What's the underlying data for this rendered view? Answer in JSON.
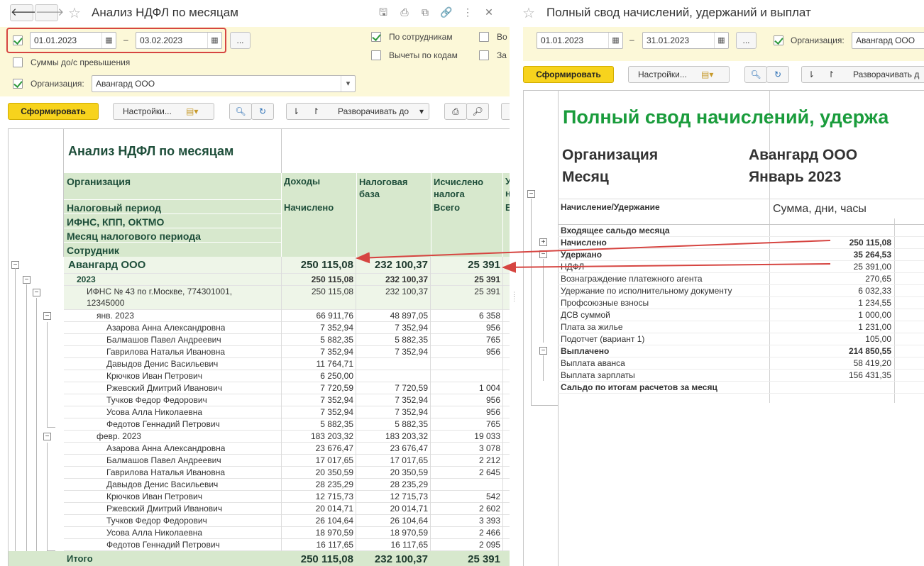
{
  "left": {
    "title": "Анализ НДФЛ по месяцам",
    "date_from": "01.01.2023",
    "date_sep": "–",
    "date_to": "03.02.2023",
    "more_btn": "...",
    "opt_by_employee": "По сотрудникам",
    "opt_deductions": "Вычеты по кодам",
    "opt_cut1": "Во",
    "opt_cut2": "За",
    "opt_excess": "Суммы до/с превышения",
    "org_label": "Организация:",
    "org_value": "Авангард ООО",
    "btn_generate": "Сформировать",
    "btn_settings": "Настройки...",
    "btn_expand": "Разворачивать до",
    "report_title": "Анализ НДФЛ по месяцам",
    "headers": {
      "org": "Организация",
      "period": "Налоговый период",
      "ifns": "ИФНС, КПП, ОКТМО",
      "month": "Месяц налогового периода",
      "employee": "Сотрудник",
      "income": "Доходы",
      "accrued": "Начислено",
      "base": "Налоговая база",
      "calc": "Исчислено налога",
      "total": "Всего",
      "cut": "У",
      "cut2": "н",
      "cut3": "В"
    },
    "rows": [
      {
        "name": "Авангард ООО",
        "income": "250 115,08",
        "base": "232 100,37",
        "calc": "25 391",
        "level": "org"
      },
      {
        "name": "2023",
        "income": "250 115,08",
        "base": "232 100,37",
        "calc": "25 391",
        "level": "year"
      },
      {
        "name": "ИФНС № 43 по г.Москве, 774301001,",
        "name2": "12345000",
        "income": "250 115,08",
        "base": "232 100,37",
        "calc": "25 391",
        "level": "ifns"
      },
      {
        "name": "янв. 2023",
        "income": "66 911,76",
        "base": "48 897,05",
        "calc": "6 358",
        "level": "month"
      },
      {
        "name": "Азарова Анна Александровна",
        "income": "7 352,94",
        "base": "7 352,94",
        "calc": "956",
        "level": "emp"
      },
      {
        "name": "Балмашов Павел Андреевич",
        "income": "5 882,35",
        "base": "5 882,35",
        "calc": "765",
        "level": "emp"
      },
      {
        "name": "Гаврилова Наталья Ивановна",
        "income": "7 352,94",
        "base": "7 352,94",
        "calc": "956",
        "level": "emp"
      },
      {
        "name": "Давыдов Денис Васильевич",
        "income": "11 764,71",
        "base": "",
        "calc": "",
        "level": "emp"
      },
      {
        "name": "Крючков Иван Петрович",
        "income": "6 250,00",
        "base": "",
        "calc": "",
        "level": "emp"
      },
      {
        "name": "Ржевский Дмитрий Иванович",
        "income": "7 720,59",
        "base": "7 720,59",
        "calc": "1 004",
        "level": "emp"
      },
      {
        "name": "Тучков Федор Федорович",
        "income": "7 352,94",
        "base": "7 352,94",
        "calc": "956",
        "level": "emp"
      },
      {
        "name": "Усова Алла Николаевна",
        "income": "7 352,94",
        "base": "7 352,94",
        "calc": "956",
        "level": "emp"
      },
      {
        "name": "Федотов Геннадий Петрович",
        "income": "5 882,35",
        "base": "5 882,35",
        "calc": "765",
        "level": "emp"
      },
      {
        "name": "февр. 2023",
        "income": "183 203,32",
        "base": "183 203,32",
        "calc": "19 033",
        "level": "month"
      },
      {
        "name": "Азарова Анна Александровна",
        "income": "23 676,47",
        "base": "23 676,47",
        "calc": "3 078",
        "level": "emp"
      },
      {
        "name": "Балмашов Павел Андреевич",
        "income": "17 017,65",
        "base": "17 017,65",
        "calc": "2 212",
        "level": "emp"
      },
      {
        "name": "Гаврилова Наталья Ивановна",
        "income": "20 350,59",
        "base": "20 350,59",
        "calc": "2 645",
        "level": "emp"
      },
      {
        "name": "Давыдов Денис Васильевич",
        "income": "28 235,29",
        "base": "28 235,29",
        "calc": "",
        "level": "emp"
      },
      {
        "name": "Крючков Иван Петрович",
        "income": "12 715,73",
        "base": "12 715,73",
        "calc": "542",
        "level": "emp"
      },
      {
        "name": "Ржевский Дмитрий Иванович",
        "income": "20 014,71",
        "base": "20 014,71",
        "calc": "2 602",
        "level": "emp"
      },
      {
        "name": "Тучков Федор Федорович",
        "income": "26 104,64",
        "base": "26 104,64",
        "calc": "3 393",
        "level": "emp"
      },
      {
        "name": "Усова Алла Николаевна",
        "income": "18 970,59",
        "base": "18 970,59",
        "calc": "2 466",
        "level": "emp"
      },
      {
        "name": "Федотов Геннадий Петрович",
        "income": "16 117,65",
        "base": "16 117,65",
        "calc": "2 095",
        "level": "emp"
      }
    ],
    "total": {
      "name": "Итого",
      "income": "250 115,08",
      "base": "232 100,37",
      "calc": "25 391"
    }
  },
  "right": {
    "title": "Полный свод начислений, удержаний и выплат",
    "date_from": "01.01.2023",
    "date_sep": "–",
    "date_to": "31.01.2023",
    "more_btn": "...",
    "org_label": "Организация:",
    "org_value": "Авангард ООО",
    "btn_generate": "Сформировать",
    "btn_settings": "Настройки...",
    "btn_expand": "Разворачивать д",
    "report_title": "Полный свод начислений, удержа",
    "org_caption": "Организация",
    "org_name": "Авангард ООО",
    "month_caption": "Месяц",
    "month_value": "Январь 2023",
    "col_item": "Начисление/Удержание",
    "col_sum": "Сумма, дни, часы",
    "rows": [
      {
        "name": "Входящее сальдо месяца",
        "value": "",
        "bold": true,
        "ind": 0
      },
      {
        "name": "Начислено",
        "value": "250 115,08",
        "bold": true,
        "ind": 0
      },
      {
        "name": "Удержано",
        "value": "35 264,53",
        "bold": true,
        "ind": 0
      },
      {
        "name": "НДФЛ",
        "value": "25 391,00",
        "bold": false,
        "ind": 0
      },
      {
        "name": "Вознаграждение платежного агента",
        "value": "270,65",
        "bold": false,
        "ind": 0
      },
      {
        "name": "Удержание по исполнительному документу",
        "value": "6 032,33",
        "bold": false,
        "ind": 0
      },
      {
        "name": "Профсоюзные взносы",
        "value": "1 234,55",
        "bold": false,
        "ind": 0
      },
      {
        "name": "ДСВ суммой",
        "value": "1 000,00",
        "bold": false,
        "ind": 0
      },
      {
        "name": "Плата за жилье",
        "value": "1 231,00",
        "bold": false,
        "ind": 0
      },
      {
        "name": "Подотчет (вариант 1)",
        "value": "105,00",
        "bold": false,
        "ind": 0
      },
      {
        "name": "Выплачено",
        "value": "214 850,55",
        "bold": true,
        "ind": 0
      },
      {
        "name": "Выплата аванса",
        "value": "58 419,20",
        "bold": false,
        "ind": 0
      },
      {
        "name": "Выплата зарплаты",
        "value": "156 431,35",
        "bold": false,
        "ind": 0
      },
      {
        "name": "Сальдо по итогам расчетов за месяц",
        "value": "",
        "bold": true,
        "ind": 0
      }
    ]
  },
  "colors": {
    "accent_green": "#1a9c3c",
    "header_green": "#d7e8cd",
    "row_green": "#eef5e8",
    "arrow_red": "#d64541",
    "yellow_button": "#f7d31d"
  }
}
